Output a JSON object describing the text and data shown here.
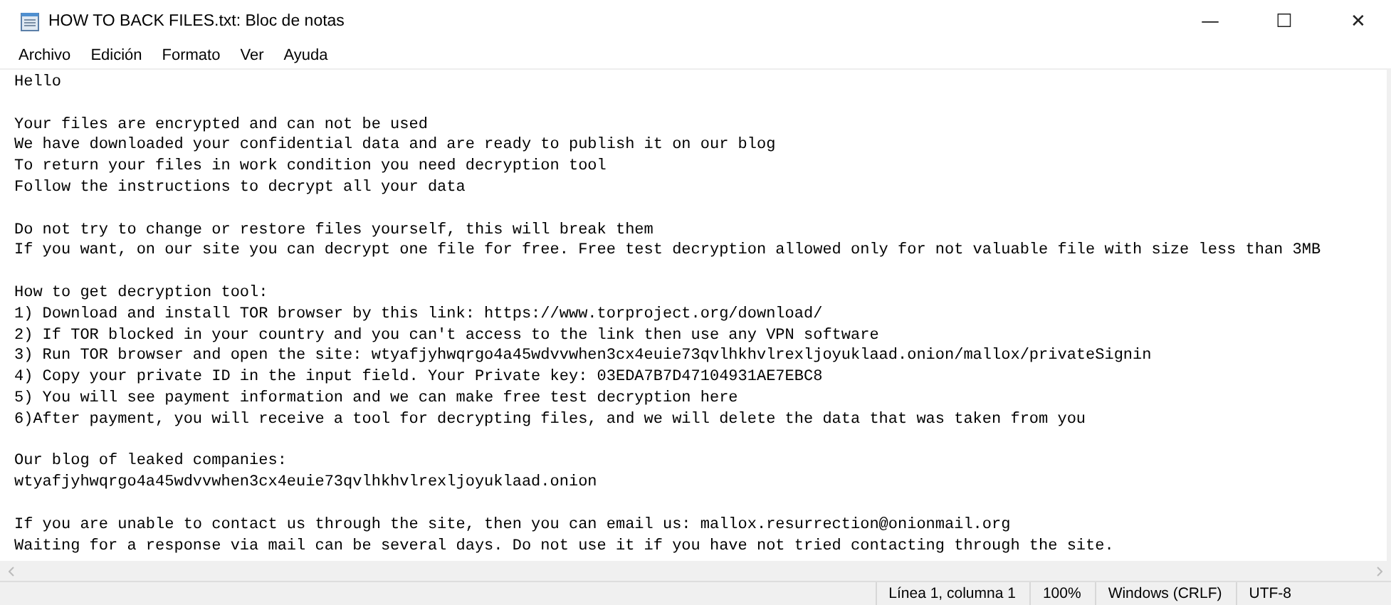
{
  "window": {
    "title": "HOW TO BACK FILES.txt: Bloc de notas",
    "controls": [
      "—",
      "☐",
      "✕"
    ]
  },
  "menu": [
    "Archivo",
    "Edición",
    "Formato",
    "Ver",
    "Ayuda"
  ],
  "document": {
    "paragraphs": [
      [
        "Hello"
      ],
      [
        "Your files are encrypted and can not be used",
        "We have downloaded your confidential data and are ready to publish it on our blog",
        "To return your files in work condition you need decryption tool",
        "Follow the instructions to decrypt all your data"
      ],
      [
        "Do not try to change or restore files yourself, this will break them",
        "If you want, on our site you can decrypt one file for free. Free test decryption allowed only for not valuable file with size less than 3MB"
      ],
      [
        "How to get decryption tool:",
        "1) Download and install TOR browser by this link: https://www.torproject.org/download/",
        "2) If TOR blocked in your country and you can't access to the link then use any VPN software",
        "3) Run TOR browser and open the site: wtyafjyhwqrgo4a45wdvvwhen3cx4euie73qvlhkhvlrexljoyuklaad.onion/mallox/privateSignin",
        "4) Copy your private ID in the input field. Your Private key: 03EDA7B7D47104931AE7EBC8",
        "5) You will see payment information and we can make free test decryption here",
        "6)After payment, you will receive a tool for decrypting files, and we will delete the data that was taken from you"
      ],
      [
        "Our blog of leaked companies:",
        "wtyafjyhwqrgo4a45wdvvwhen3cx4euie73qvlhkhvlrexljoyuklaad.onion"
      ],
      [
        "If you are unable to contact us through the site, then you can email us: mallox.resurrection@onionmail.org",
        "Waiting for a response via mail can be several days. Do not use it if you have not tried contacting through the site."
      ]
    ]
  },
  "status_bar": [
    "Línea 1, columna 1",
    "100%",
    "Windows (CRLF)",
    "UTF-8"
  ]
}
